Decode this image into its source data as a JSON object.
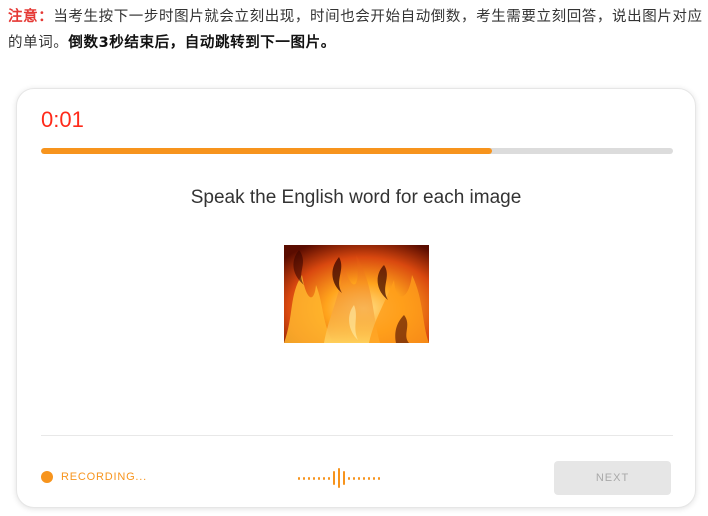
{
  "notice": {
    "label": "注意：",
    "text": "当考生按下一步时图片就会立刻出现，时间也会开始自动倒数，考生需要立刻回答，说出图片对应的单词。",
    "bold_text": "倒数3秒结束后，自动跳转到下一图片。"
  },
  "task": {
    "timer": "0:01",
    "progress_fraction": 0.713,
    "prompt": "Speak the English word for each image",
    "image_icon": "fire-photo"
  },
  "footer": {
    "recording_label": "RECORDING...",
    "next_label": "NEXT"
  },
  "colors": {
    "accent": "#f7941d",
    "timer": "#ff2a1a",
    "notice_label": "#e53935",
    "disabled_button": "#e6e6e6"
  }
}
